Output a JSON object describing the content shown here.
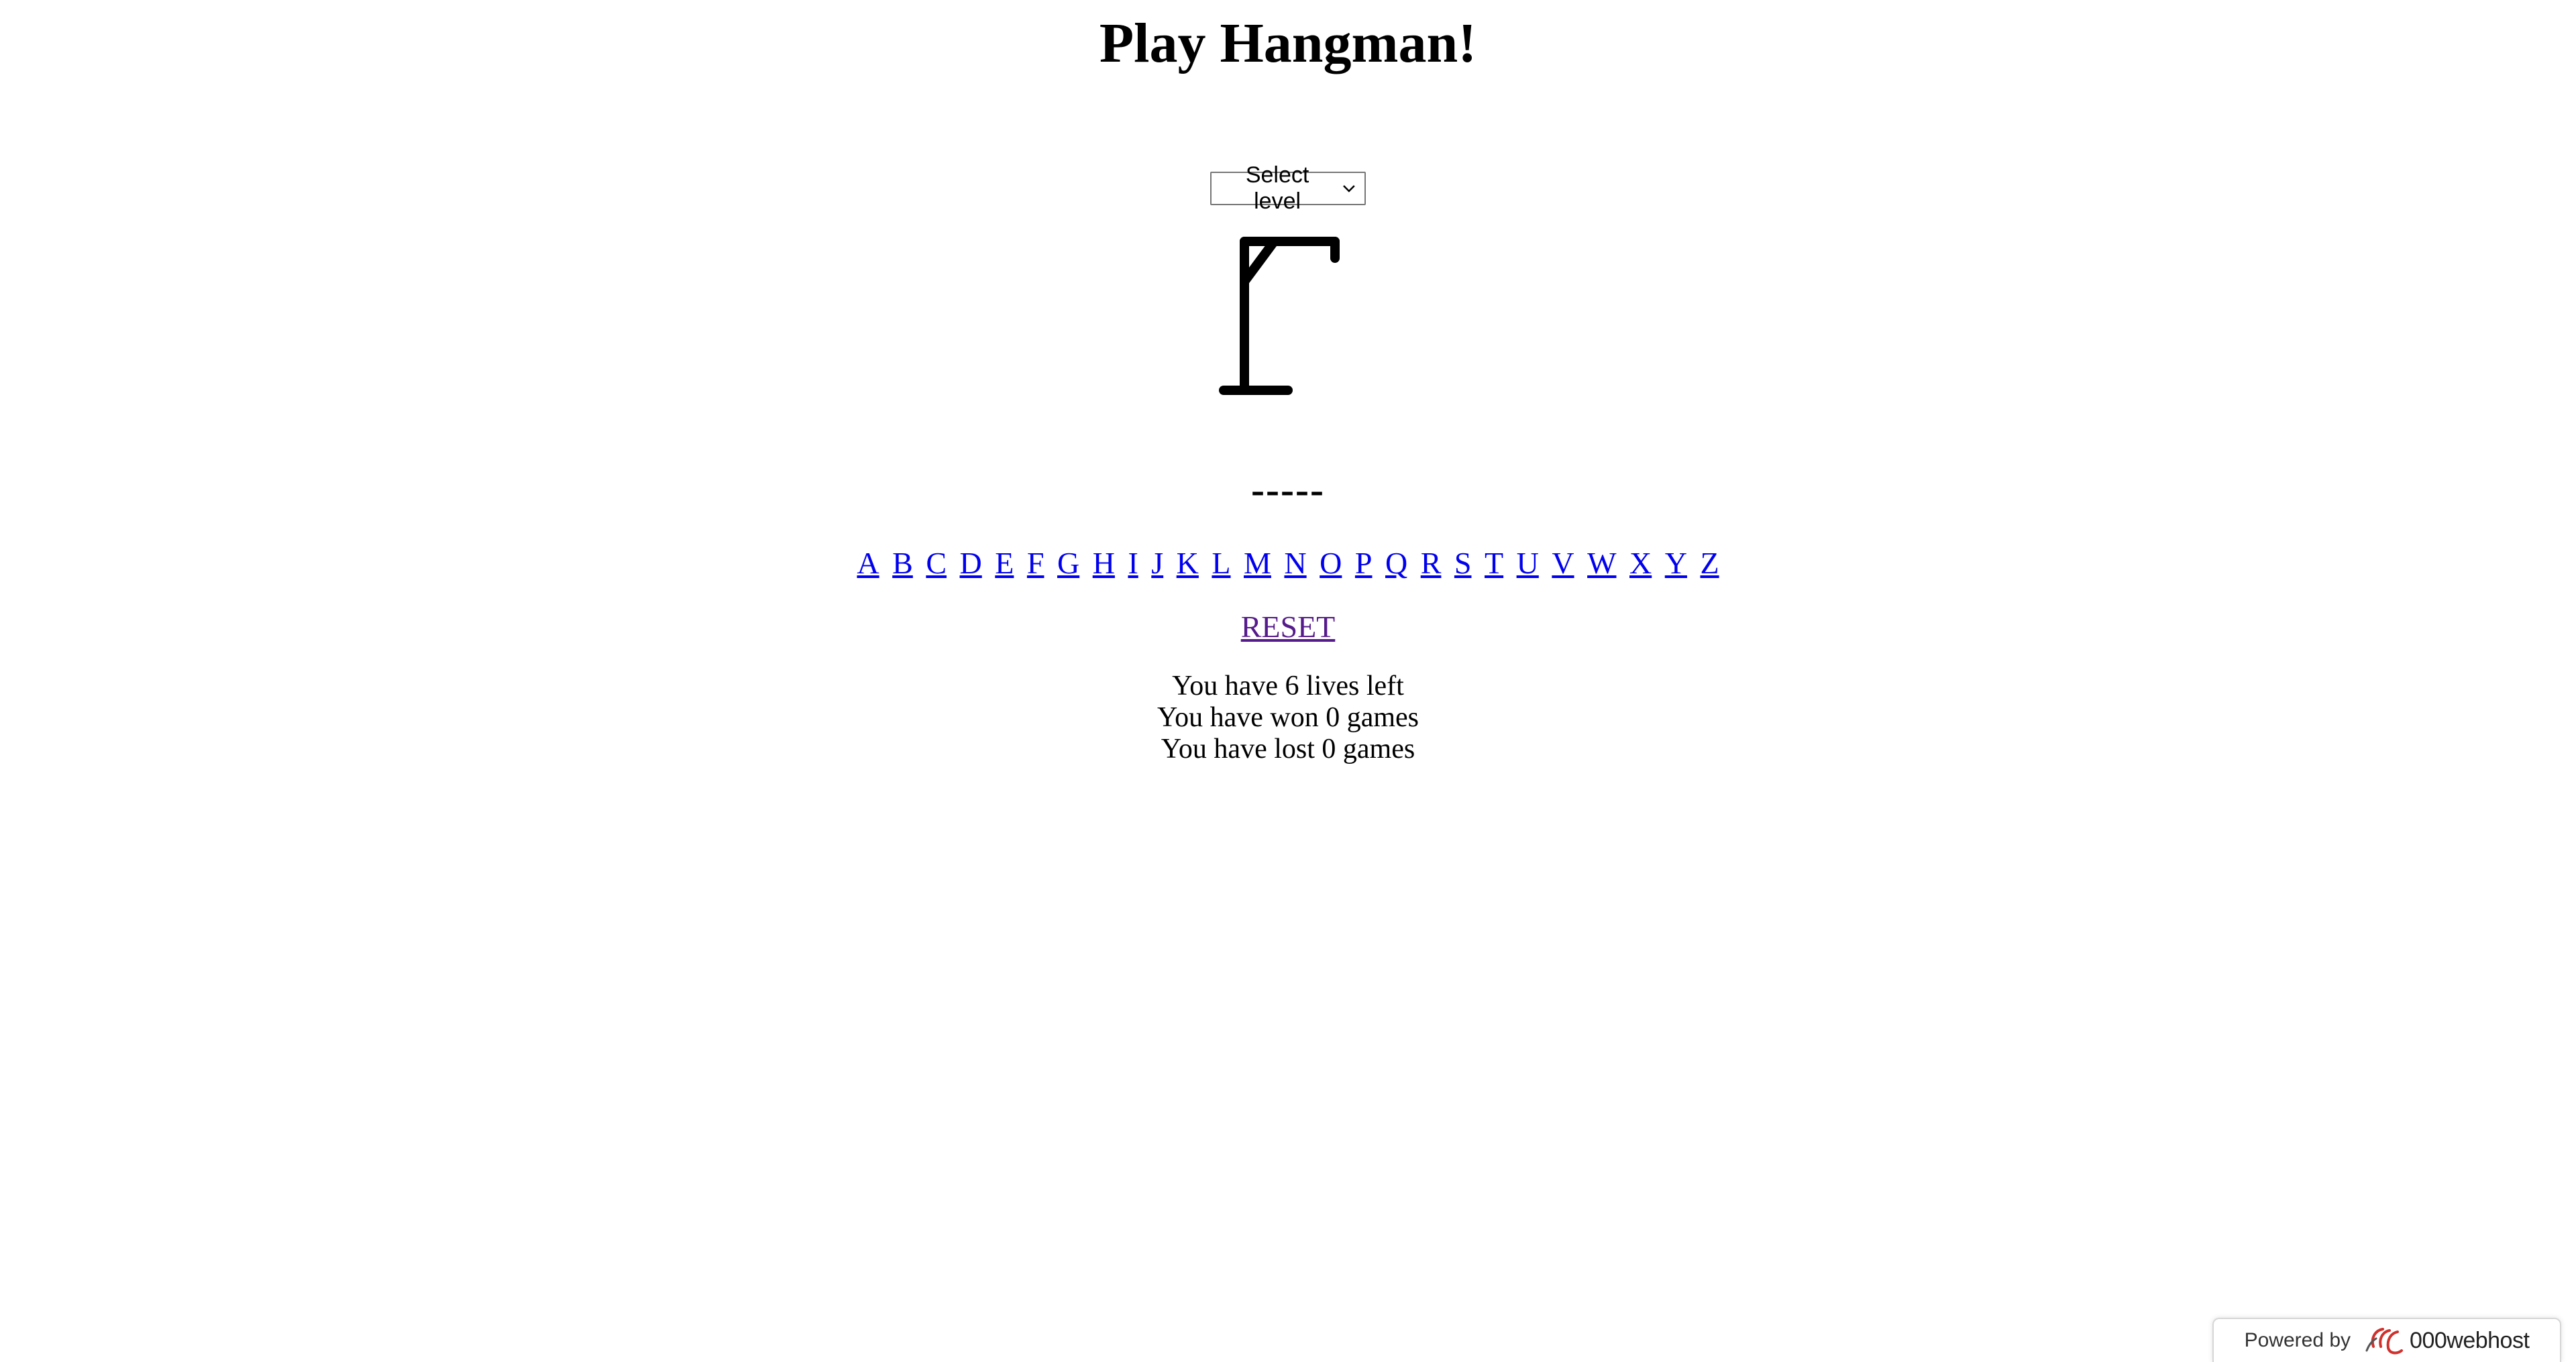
{
  "title": "Play Hangman!",
  "level_select": {
    "selected": "Select level",
    "icon": "chevron-down-icon"
  },
  "gallows": {
    "icon": "gallows-icon",
    "stroke_color": "#000000"
  },
  "word_display": "-----",
  "letters": [
    "A",
    "B",
    "C",
    "D",
    "E",
    "F",
    "G",
    "H",
    "I",
    "J",
    "K",
    "L",
    "M",
    "N",
    "O",
    "P",
    "Q",
    "R",
    "S",
    "T",
    "U",
    "V",
    "W",
    "X",
    "Y",
    "Z"
  ],
  "reset_label": "RESET",
  "stats": {
    "lives": "You have 6 lives left",
    "won": "You have won 0 games",
    "lost": "You have lost 0 games"
  },
  "footer_badge": {
    "powered_by": "Powered by",
    "brand": "000webhost",
    "logo_icon": "000webhost-logo-icon"
  },
  "colors": {
    "link": "#0000ee",
    "visited_link": "#551a8b",
    "logo_red": "#d0312d"
  }
}
